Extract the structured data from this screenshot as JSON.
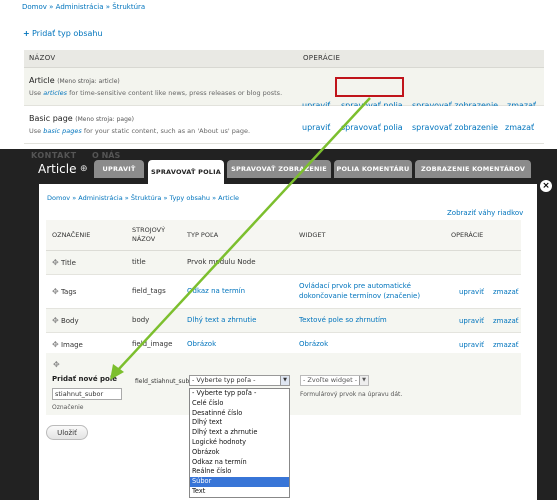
{
  "top": {
    "breadcrumb": "Domov » Administrácia » Štruktúra",
    "add_link": "Pridať typ obsahu",
    "columns": [
      "NÁZOV",
      "OPERÁCIE"
    ],
    "rows": [
      {
        "name": "Article",
        "machine": "(Meno stroja: article)",
        "desc_pre": "Use ",
        "desc_em": "articles",
        "desc_post": " for time-sensitive content like news, press releases or blog posts.",
        "ops": [
          "upraviť",
          "spravovať polia",
          "spravovať zobrazenie",
          "zmazať"
        ]
      },
      {
        "name": "Basic page",
        "machine": "(Meno stroja: page)",
        "desc_pre": "Use ",
        "desc_em": "basic pages",
        "desc_post": " for your static content, such as an 'About us' page.",
        "ops": [
          "upraviť",
          "spravovať polia",
          "spravovať zobrazenie",
          "zmazať"
        ]
      }
    ]
  },
  "overlay": {
    "bg_nav": [
      "KONTAKT",
      "O NÁS"
    ],
    "title": "Article",
    "tabs": [
      "UPRAVIŤ",
      "SPRAVOVAŤ POLIA",
      "SPRAVOVAŤ ZOBRAZENIE",
      "POLIA KOMENTÁRU",
      "ZOBRAZENIE KOMENTÁROV"
    ],
    "close": "×",
    "breadcrumb": "Domov » Administrácia » Štruktúra » Typy obsahu » Article",
    "weights_link": "Zobraziť váhy riadkov",
    "columns": [
      "OZNAČENIE",
      "STROJOVÝ NÁZOV",
      "TYP POĽA",
      "WIDGET",
      "OPERÁCIE"
    ],
    "fields": [
      {
        "label": "Title",
        "machine": "title",
        "type": "Prvok modulu Node",
        "widget": "",
        "edit": "",
        "delete": ""
      },
      {
        "label": "Tags",
        "machine": "field_tags",
        "type": "Odkaz na termín",
        "widget": "Ovládací prvok pre automatické dokončovanie termínov (značenie)",
        "edit": "upraviť",
        "delete": "zmazať"
      },
      {
        "label": "Body",
        "machine": "body",
        "type": "Dlhý text a zhrnutie",
        "widget": "Textové pole so zhrnutím",
        "edit": "upraviť",
        "delete": "zmazať"
      },
      {
        "label": "Image",
        "machine": "field_image",
        "type": "Obrázok",
        "widget": "Obrázok",
        "edit": "upraviť",
        "delete": "zmazať"
      }
    ],
    "new_field": {
      "label": "Pridať nové pole",
      "input_value": "stiahnut_subor",
      "input_sub": "Označenie",
      "machine": "field_stiahnut_subor",
      "type_select": "- Vyberte typ poľa -",
      "widget_select": "- Zvoľte widget -",
      "hint": "Formulárový prvok na úpravu dát."
    },
    "save": "Uložiť",
    "dropdown": [
      "- Vyberte typ poľa -",
      "Celé číslo",
      "Desatinné číslo",
      "Dlhý text",
      "Dlhý text a zhrnutie",
      "Logické hodnoty",
      "Obrázok",
      "Odkaz na termín",
      "Reálne číslo",
      "Súbor",
      "Text"
    ],
    "dropdown_selected": "Súbor"
  },
  "colors": {
    "link": "#0074bd",
    "highlight": "#c0141b",
    "arrow": "#7cbf2e",
    "dark": "#222222",
    "select": "#3875d7"
  }
}
